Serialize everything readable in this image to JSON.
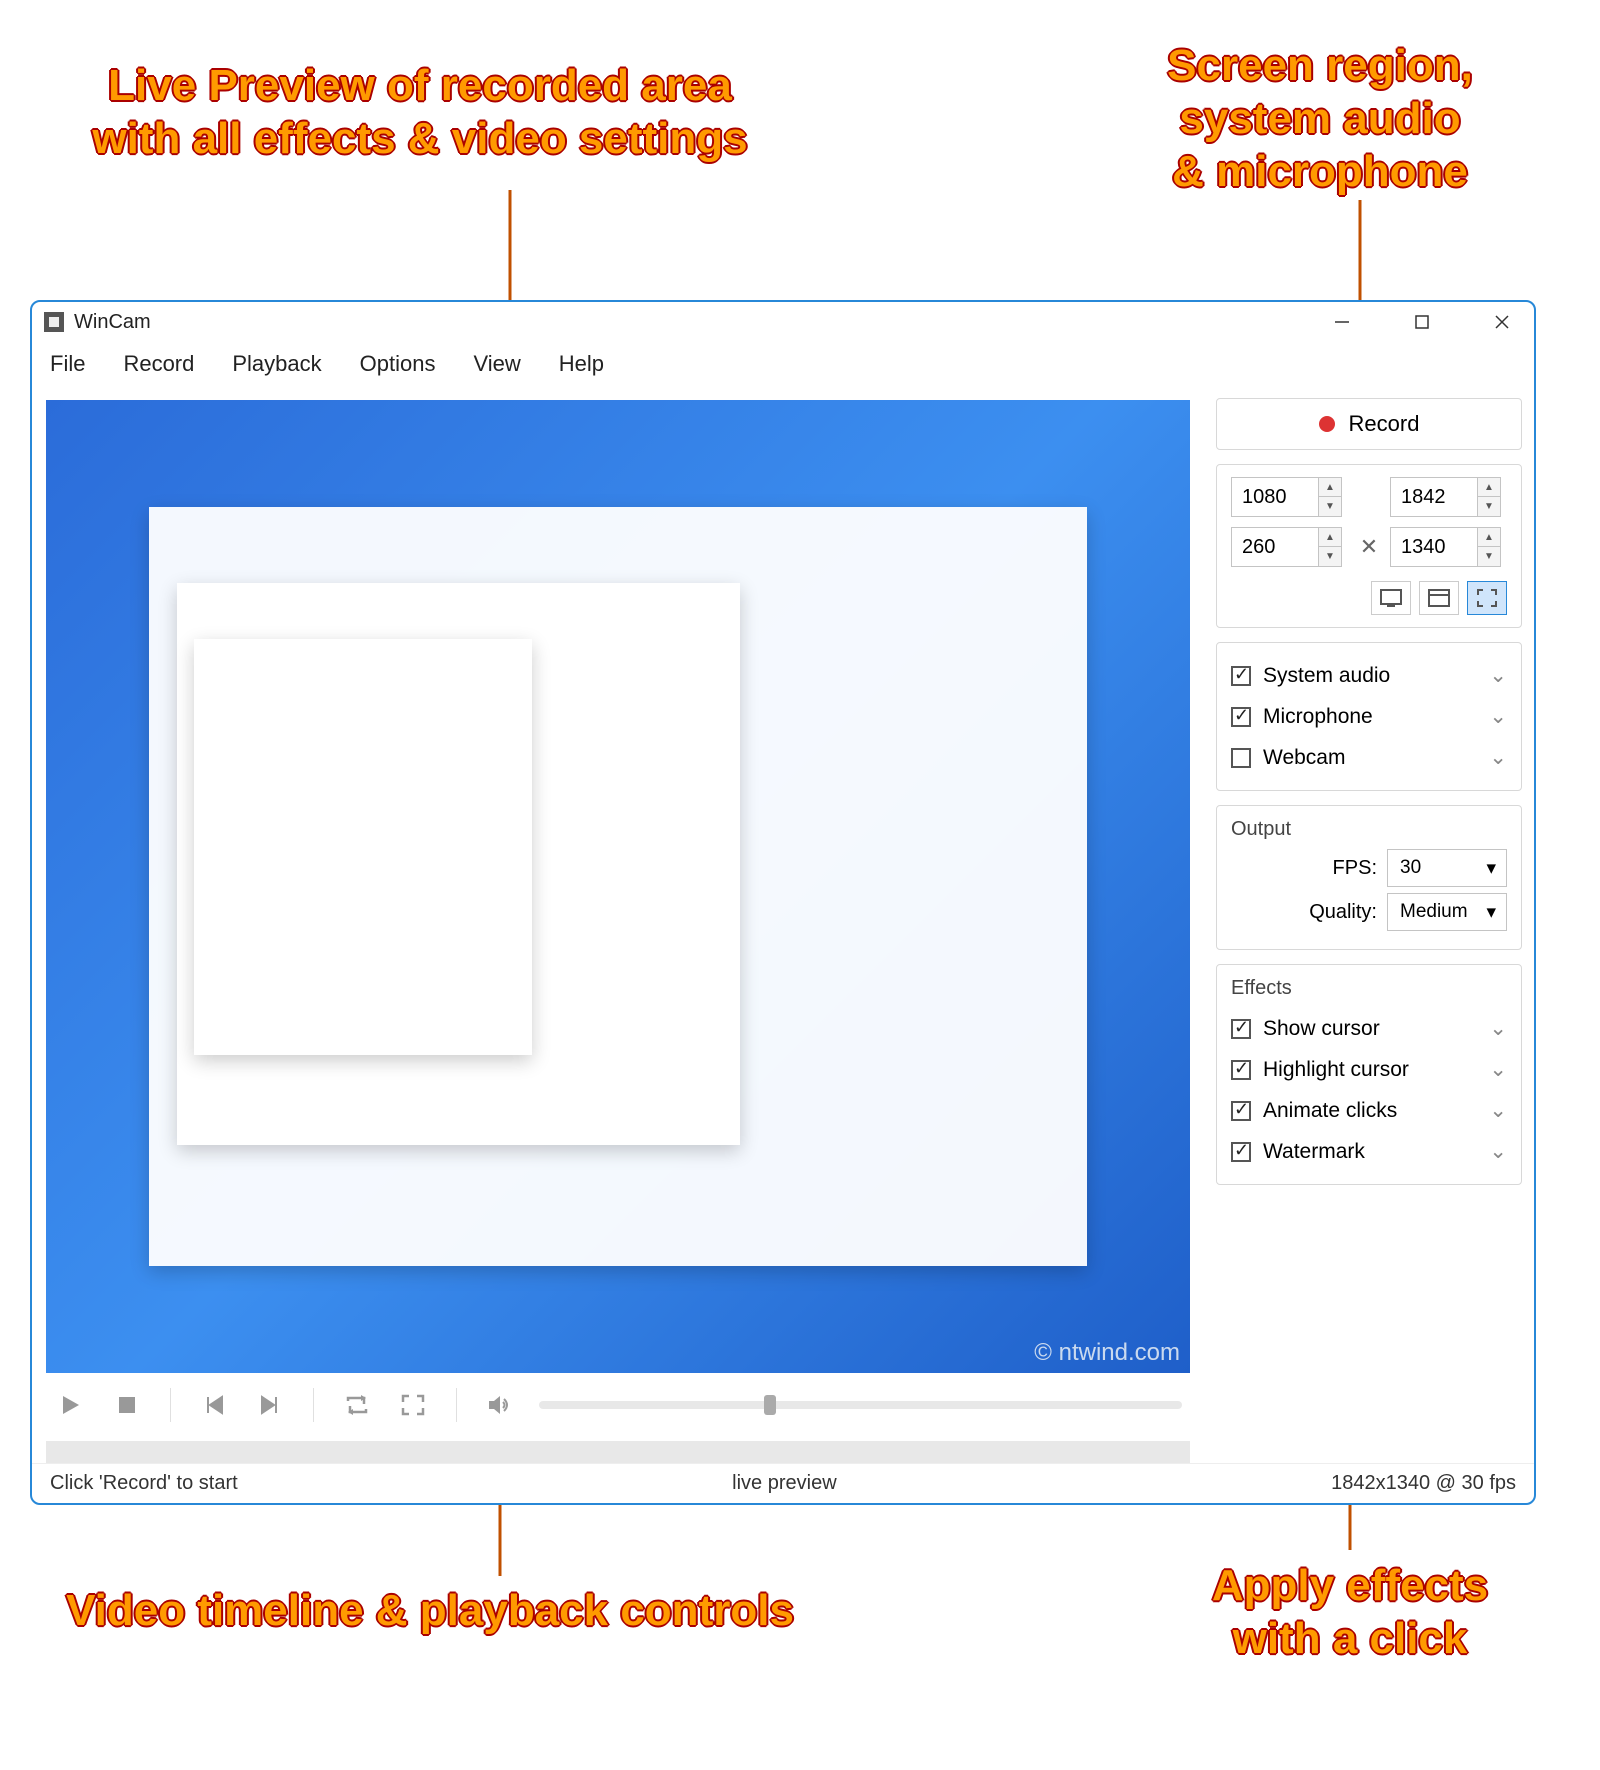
{
  "callouts": {
    "topLeft": "Live Preview of recorded area\nwith all effects & video settings",
    "topRight": "Screen region,\nsystem audio\n& microphone",
    "bottomLeft": "Video timeline & playback controls",
    "bottomRight": "Apply effects\nwith a click"
  },
  "title": "WinCam",
  "menu": {
    "file": "File",
    "record": "Record",
    "playback": "Playback",
    "options": "Options",
    "view": "View",
    "help": "Help"
  },
  "watermark": "© ntwind.com",
  "record": {
    "label": "Record"
  },
  "dims": {
    "x1": "1080",
    "y1": "260",
    "x2": "1842",
    "y2": "1340"
  },
  "audio": {
    "system": "System audio",
    "mic": "Microphone",
    "webcam": "Webcam",
    "systemOn": true,
    "micOn": true,
    "webcamOn": false
  },
  "output": {
    "title": "Output",
    "fpsLabel": "FPS:",
    "fps": "30",
    "qualityLabel": "Quality:",
    "quality": "Medium"
  },
  "effects": {
    "title": "Effects",
    "items": [
      {
        "label": "Show cursor",
        "on": true
      },
      {
        "label": "Highlight cursor",
        "on": true
      },
      {
        "label": "Animate clicks",
        "on": true
      },
      {
        "label": "Watermark",
        "on": true
      }
    ]
  },
  "status": {
    "left": "Click 'Record' to start",
    "mid": "live preview",
    "right": "1842x1340 @ 30 fps"
  }
}
